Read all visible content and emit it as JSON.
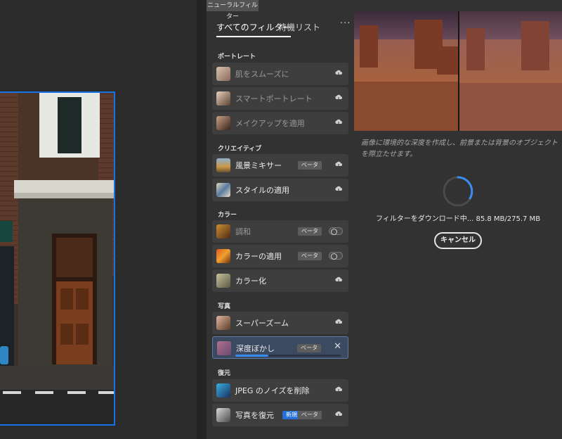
{
  "panel": {
    "tab_title": "ニューラルフィルター",
    "tabs": [
      {
        "label": "すべてのフィルター"
      },
      {
        "label": "待機リスト"
      }
    ],
    "more_label": "···"
  },
  "sections": {
    "portrait": "ポートレート",
    "creative": "クリエイティブ",
    "color": "カラー",
    "photo": "写真",
    "restore": "復元"
  },
  "filters": {
    "smooth_skin": {
      "label": "肌をスムーズに"
    },
    "smart_portrait": {
      "label": "スマートポートレート"
    },
    "makeup": {
      "label": "メイクアップを適用"
    },
    "landscape_mixer": {
      "label": "風景ミキサー",
      "badge": "ベータ"
    },
    "style_transfer": {
      "label": "スタイルの適用"
    },
    "harmonize": {
      "label": "調和",
      "badge": "ベータ"
    },
    "color_transfer": {
      "label": "カラーの適用",
      "badge": "ベータ"
    },
    "colorize": {
      "label": "カラー化"
    },
    "super_zoom": {
      "label": "スーパーズーム"
    },
    "depth_blur": {
      "label": "深度ぼかし",
      "badge": "ベータ",
      "download_progress": 0.31
    },
    "jpeg_artifacts": {
      "label": "JPEG のノイズを削除"
    },
    "photo_restore": {
      "label": "写真を復元",
      "new_badge": "新規",
      "badge": "ベータ"
    }
  },
  "preview": {
    "description": "画像に環境的な深度を作成し、前景または背景のオブジェクトを際立たせます。",
    "status": "フィルターをダウンロード中... 85.8 MB/275.7 MB",
    "cancel_label": "キャンセル"
  },
  "colors": {
    "accent": "#1473e6",
    "progress": "#3a8cf0",
    "new_badge": "#2470d8"
  },
  "icons": {
    "cloud": "cloud-download-icon",
    "close": "close-icon",
    "more": "more-icon"
  }
}
